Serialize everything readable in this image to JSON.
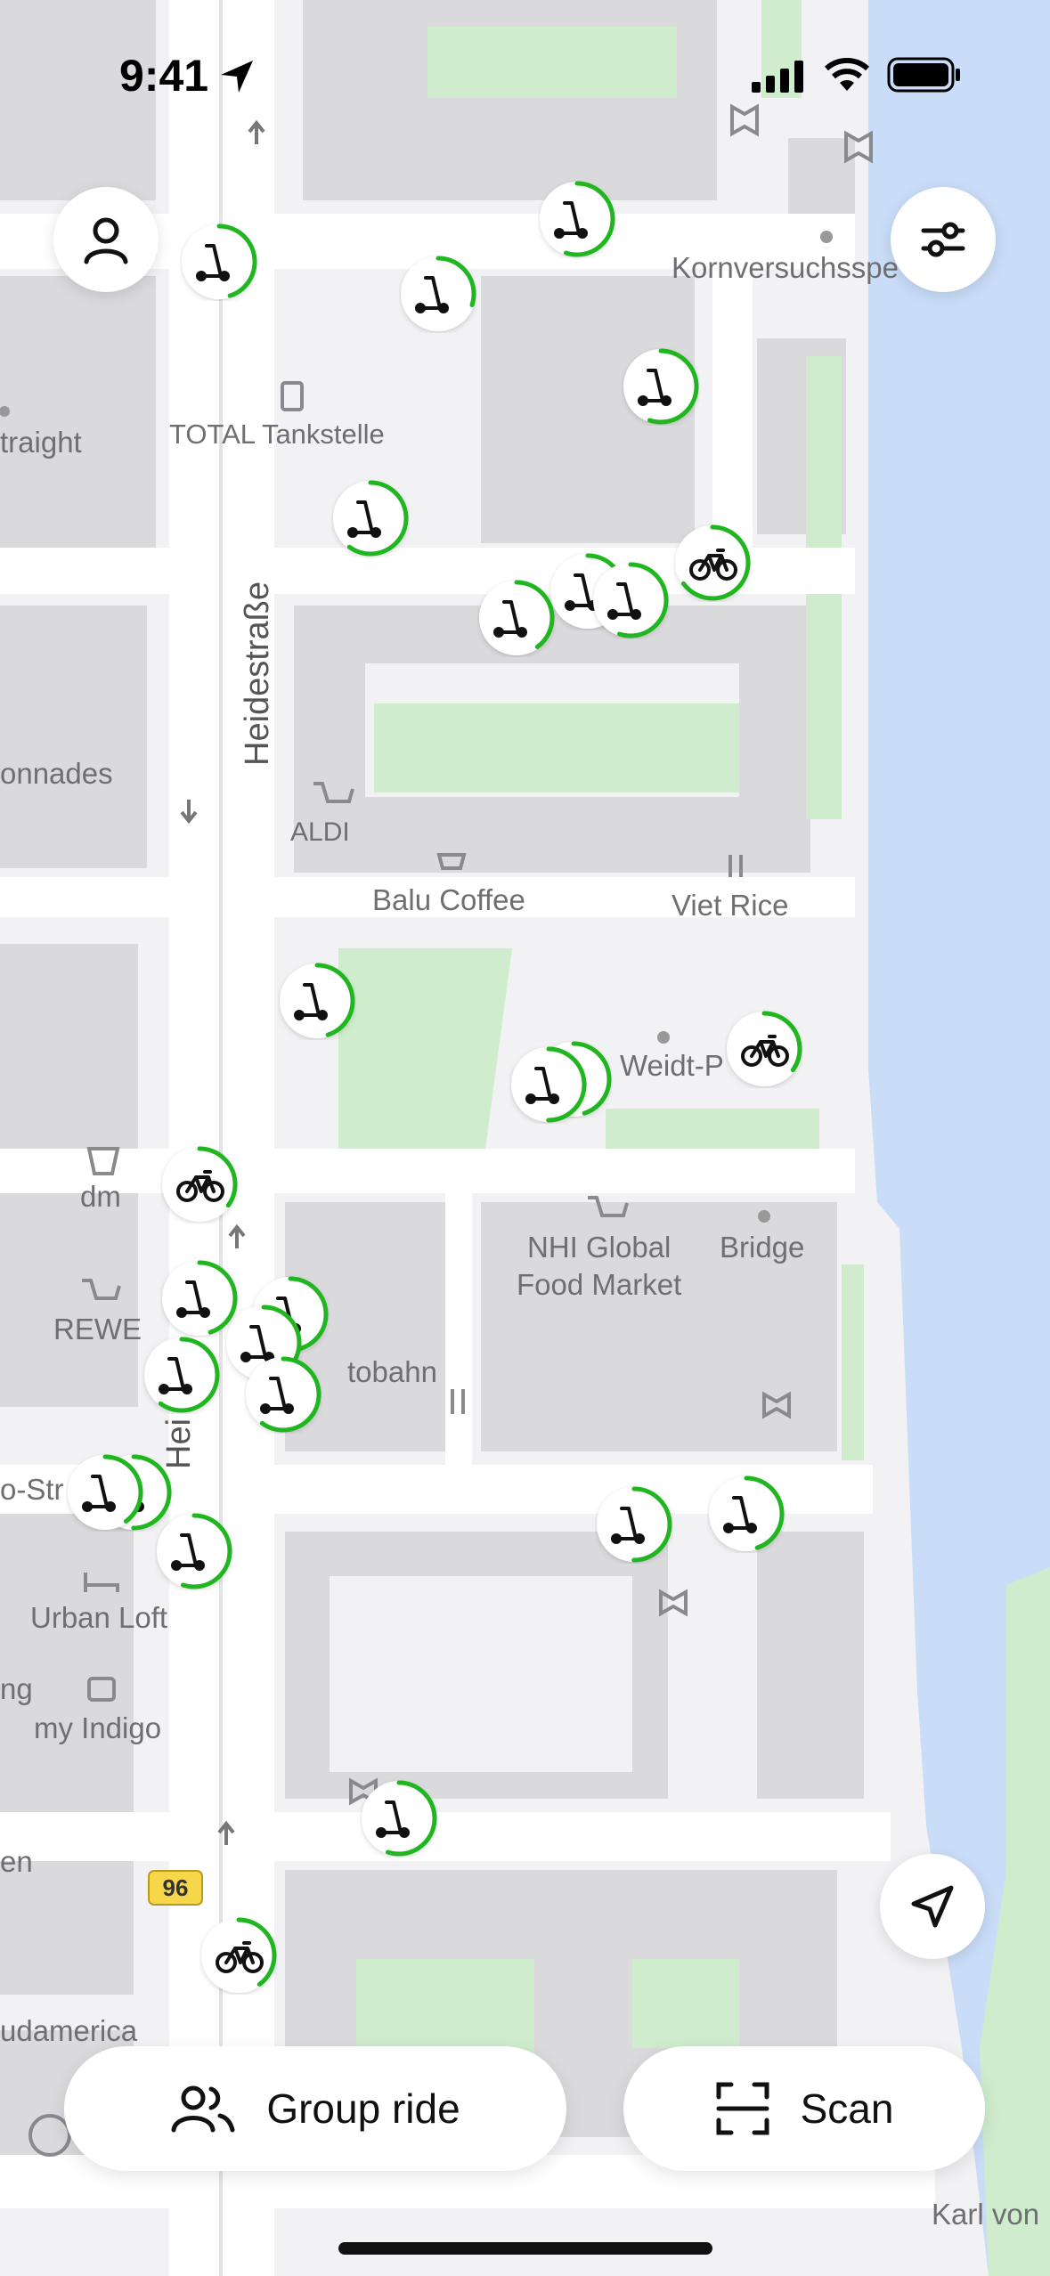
{
  "status_bar": {
    "time": "9:41"
  },
  "map": {
    "street_name": "Heidestraße",
    "street_name_short": "Hei",
    "route_badge": "96",
    "poi_labels": [
      "Kornversuchsspe",
      "TOTAL Tankstelle",
      "traight",
      "onnades",
      "ALDI",
      "Balu Coffee",
      "Viet Rice",
      "Weidt-P",
      "dm",
      "NHI Global",
      "Food Market",
      "Bridge",
      "REWE",
      "tobahn",
      "o-Str",
      "Urban Loft",
      "ng",
      "my Indigo",
      "en",
      "udamerica",
      "Karl von"
    ]
  },
  "buttons": {
    "profile": "profile",
    "filters": "filters",
    "locate": "locate-me",
    "group_ride_label": "Group ride",
    "scan_label": "Scan"
  },
  "icons": {
    "profile": "person-icon",
    "filters": "sliders-icon",
    "locate": "navigation-arrow-icon",
    "group_ride": "people-icon",
    "scan": "scan-frame-icon",
    "scooter": "scooter-icon",
    "bike": "bike-icon"
  },
  "colors": {
    "accent_green": "#1fb61f",
    "water": "#c9ddf8",
    "park": "#cfeccd",
    "building": "#dadadd",
    "road": "#ffffff"
  },
  "vehicles": [
    {
      "type": "scooter",
      "battery": 0.55
    },
    {
      "type": "scooter",
      "battery": 0.45
    },
    {
      "type": "scooter",
      "battery": 0.3
    },
    {
      "type": "scooter",
      "battery": 0.55
    },
    {
      "type": "scooter",
      "battery": 0.6
    },
    {
      "type": "scooter",
      "battery": 0.35
    },
    {
      "type": "scooter",
      "battery": 0.4
    },
    {
      "type": "scooter",
      "battery": 0.55
    },
    {
      "type": "bike",
      "battery": 0.65
    },
    {
      "type": "scooter",
      "battery": 0.45
    },
    {
      "type": "scooter",
      "battery": 0.45
    },
    {
      "type": "bike",
      "battery": 0.35
    },
    {
      "type": "bike",
      "battery": 0.35
    },
    {
      "type": "scooter",
      "battery": 0.5
    },
    {
      "type": "scooter",
      "battery": 0.45
    },
    {
      "type": "scooter",
      "battery": 0.55
    },
    {
      "type": "scooter",
      "battery": 0.45
    },
    {
      "type": "scooter",
      "battery": 0.6
    },
    {
      "type": "scooter",
      "battery": 0.6
    },
    {
      "type": "scooter",
      "battery": 0.5
    },
    {
      "type": "scooter",
      "battery": 0.4
    },
    {
      "type": "scooter",
      "battery": 0.55
    },
    {
      "type": "scooter",
      "battery": 0.5
    },
    {
      "type": "scooter",
      "battery": 0.45
    },
    {
      "type": "scooter",
      "battery": 0.55
    },
    {
      "type": "bike",
      "battery": 0.4
    }
  ]
}
